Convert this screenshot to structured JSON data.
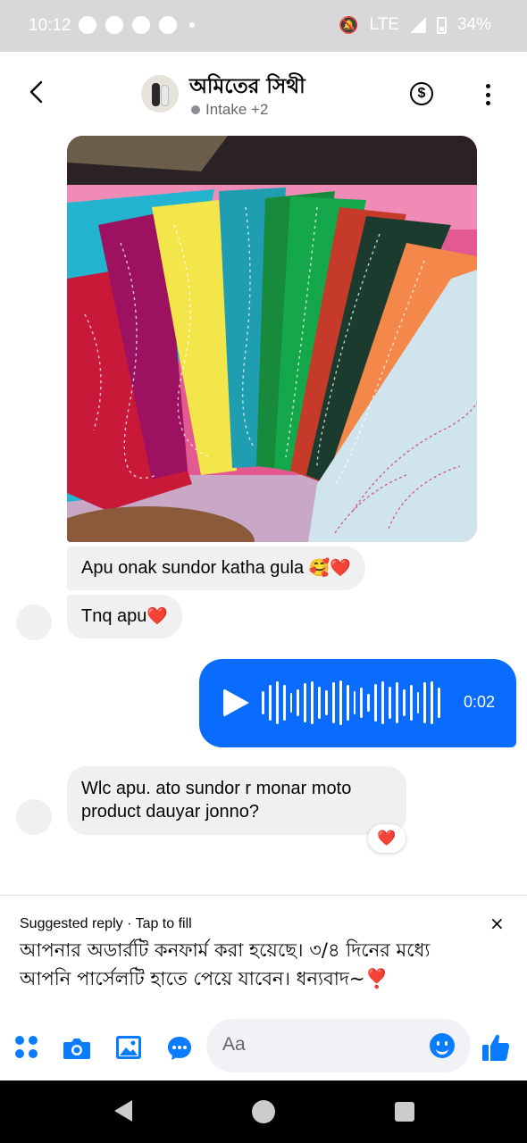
{
  "status_bar": {
    "time": "10:12",
    "network": "LTE",
    "battery": "34%"
  },
  "header": {
    "title": "অমিতের সিথী",
    "subtitle": "Intake +2",
    "icons": [
      "back-icon",
      "avatar",
      "dollar-icon",
      "more-icon"
    ]
  },
  "messages": [
    {
      "type": "photo",
      "direction": "incoming",
      "description_icon": "image"
    },
    {
      "type": "text",
      "direction": "incoming",
      "text": "Apu onak sundor katha gula",
      "emoji": "🥰❤️"
    },
    {
      "type": "text",
      "direction": "incoming",
      "text": "Tnq apu",
      "emoji": "❤️"
    },
    {
      "type": "voice",
      "direction": "outgoing",
      "duration": "0:02"
    },
    {
      "type": "text",
      "direction": "incoming",
      "text": "Wlc apu. ato sundor r monar moto product dauyar jonno?",
      "reaction": "❤️"
    }
  ],
  "suggested_reply": {
    "label": "Suggested reply · Tap to fill",
    "close": "×",
    "text": "আপনার অডার্রটি কনফার্ম করা হয়েছে। ৩/৪ দিনের মধ্যে আপনি পার্সেলটি হাতে পেয়ে যাবেন। ধন্যবাদ~❣️"
  },
  "composer": {
    "placeholder": "Aa",
    "icons": [
      "apps-icon",
      "camera-icon",
      "gallery-icon",
      "chat-icon",
      "emoji-icon",
      "like-icon"
    ]
  },
  "colors": {
    "accent": "#0a7cff",
    "outgoing_bubble": "#0a6cff",
    "incoming_bubble": "#f0f0f0",
    "heart": "#e8112d"
  }
}
